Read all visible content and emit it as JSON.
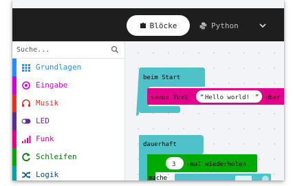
{
  "topbar": {
    "blocks_tab": "Blöcke",
    "python_tab": "Python"
  },
  "search": {
    "placeholder": "Suche..."
  },
  "categories": [
    {
      "label": "Grundlagen",
      "color": "#1e90ff",
      "icon": "grid-icon"
    },
    {
      "label": "Eingabe",
      "color": "#d400d4",
      "icon": "target-icon"
    },
    {
      "label": "Musik",
      "color": "#e63022",
      "icon": "headphones-icon"
    },
    {
      "label": "LED",
      "color": "#5c2d91",
      "icon": "toggle-icon"
    },
    {
      "label": "Funk",
      "color": "#e3008c",
      "icon": "signal-icon"
    },
    {
      "label": "Schleifen",
      "color": "#00aa00",
      "icon": "loop-icon"
    },
    {
      "label": "Logik",
      "color": "#00a4a6",
      "icon": "shuffle-icon"
    }
  ],
  "blocks": {
    "on_start": "beim Start",
    "show_string": "sende Text",
    "string_value": "Hello world!",
    "show_string_tail": "über",
    "forever": "dauerhaft",
    "repeat_count": "3",
    "repeat_label": "-mal wiederholen",
    "do_label": "mache"
  },
  "colors": {
    "basic_block": "#1e90ff",
    "radio_block": "#e3008c",
    "loops_block": "#00aa00",
    "event_block": "#4fc1c9",
    "topbar": "#1e1e1e"
  }
}
